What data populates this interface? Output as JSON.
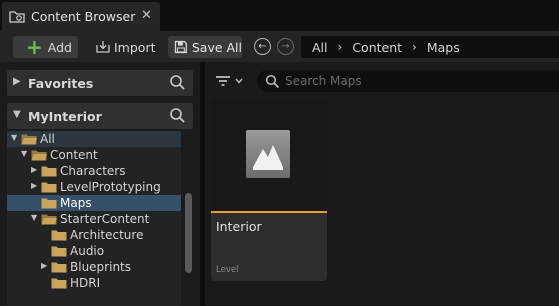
{
  "tab": {
    "title": "Content Browser",
    "close": "✕",
    "icon": "content-browser-icon"
  },
  "toolbar": {
    "add_label": "Add",
    "add_plus": "+",
    "import_label": "Import",
    "save_all_label": "Save All"
  },
  "navigation": {
    "back": "←",
    "forward": "→"
  },
  "breadcrumb": {
    "items": [
      "All",
      "Content",
      "Maps"
    ],
    "separator": "›"
  },
  "sources": {
    "favorites": {
      "label": "Favorites",
      "arrow": "▶"
    },
    "project": {
      "label": "MyInterior",
      "arrow": "▼"
    },
    "tree": [
      {
        "label": "All",
        "arrow": "▼",
        "state": "selected-parent"
      },
      {
        "label": "Content",
        "arrow": "▼",
        "state": ""
      },
      {
        "label": "Characters",
        "arrow": "▶",
        "state": ""
      },
      {
        "label": "LevelPrototyping",
        "arrow": "▶",
        "state": ""
      },
      {
        "label": "Maps",
        "arrow": "",
        "state": "selected"
      },
      {
        "label": "StarterContent",
        "arrow": "▼",
        "state": ""
      },
      {
        "label": "Architecture",
        "arrow": "",
        "state": ""
      },
      {
        "label": "Audio",
        "arrow": "",
        "state": ""
      },
      {
        "label": "Blueprints",
        "arrow": "▶",
        "state": ""
      },
      {
        "label": "HDRI",
        "arrow": "",
        "state": ""
      }
    ]
  },
  "search": {
    "placeholder": "Search Maps"
  },
  "assets": [
    {
      "name": "Interior",
      "type": "Level",
      "accent_color": "#e79a2c",
      "icon": "level-icon"
    }
  ],
  "colors": {
    "folder": "#c9a35b",
    "selection": "#34506a",
    "accent_add": "#66c14b"
  }
}
